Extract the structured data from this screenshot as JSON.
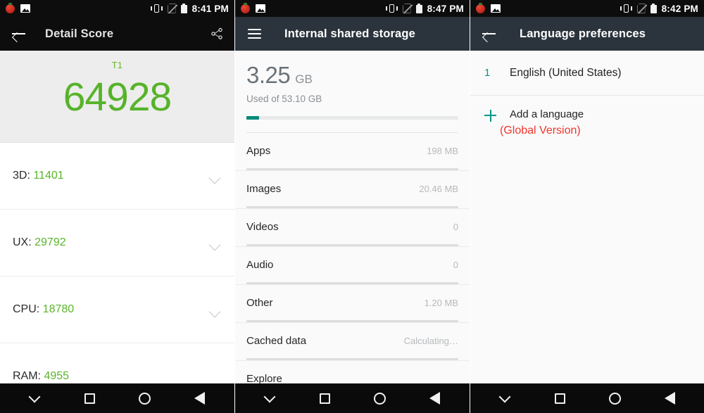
{
  "panels": [
    {
      "status_bar": {
        "left_icons": [
          "tomato-app-icon",
          "photo-icon"
        ],
        "right_icons": [
          "vibrate-icon",
          "no-sim-icon",
          "battery-icon"
        ],
        "clock": "8:41 PM"
      },
      "app_bar": {
        "back_icon": "back-arrow-icon",
        "title": "Detail Score",
        "action_icon": "share-icon"
      },
      "hero": {
        "label": "T1",
        "value": "64928"
      },
      "rows": [
        {
          "label": "3D: ",
          "value": "11401"
        },
        {
          "label": "UX: ",
          "value": "29792"
        },
        {
          "label": "CPU: ",
          "value": "18780"
        },
        {
          "label": "RAM: ",
          "value": "4955"
        }
      ],
      "nav": [
        "chevron-down-icon",
        "recents-square-icon",
        "home-circle-icon",
        "back-triangle-icon"
      ]
    },
    {
      "status_bar": {
        "left_icons": [
          "tomato-app-icon",
          "photo-icon"
        ],
        "right_icons": [
          "vibrate-icon",
          "no-sim-icon",
          "battery-icon"
        ],
        "clock": "8:47 PM"
      },
      "app_bar": {
        "menu_icon": "hamburger-icon",
        "title": "Internal shared storage"
      },
      "storage": {
        "used_value": "3.25",
        "used_unit": "GB",
        "subtitle": "Used of 53.10 GB",
        "progress_percent": 6,
        "progress_color": "#00897b"
      },
      "categories": [
        {
          "name": "Apps",
          "size": "198 MB"
        },
        {
          "name": "Images",
          "size": "20.46 MB"
        },
        {
          "name": "Videos",
          "size": "0"
        },
        {
          "name": "Audio",
          "size": "0"
        },
        {
          "name": "Other",
          "size": "1.20 MB"
        },
        {
          "name": "Cached data",
          "size": "Calculating…"
        }
      ],
      "explore": {
        "name": "Explore"
      },
      "nav": [
        "chevron-down-icon",
        "recents-square-icon",
        "home-circle-icon",
        "back-triangle-icon"
      ]
    },
    {
      "status_bar": {
        "left_icons": [
          "tomato-app-icon",
          "photo-icon"
        ],
        "right_icons": [
          "vibrate-icon",
          "no-sim-icon",
          "battery-icon"
        ],
        "clock": "8:42 PM"
      },
      "app_bar": {
        "back_icon": "back-arrow-icon",
        "title": "Language preferences"
      },
      "languages": [
        {
          "index": "1",
          "name": "English (United States)"
        }
      ],
      "add_language": {
        "plus_icon": "plus-icon",
        "label": "Add a language",
        "note": "(Global Version)",
        "note_color": "#f1352b"
      },
      "nav": [
        "chevron-down-icon",
        "recents-square-icon",
        "home-circle-icon",
        "back-triangle-icon"
      ]
    }
  ]
}
